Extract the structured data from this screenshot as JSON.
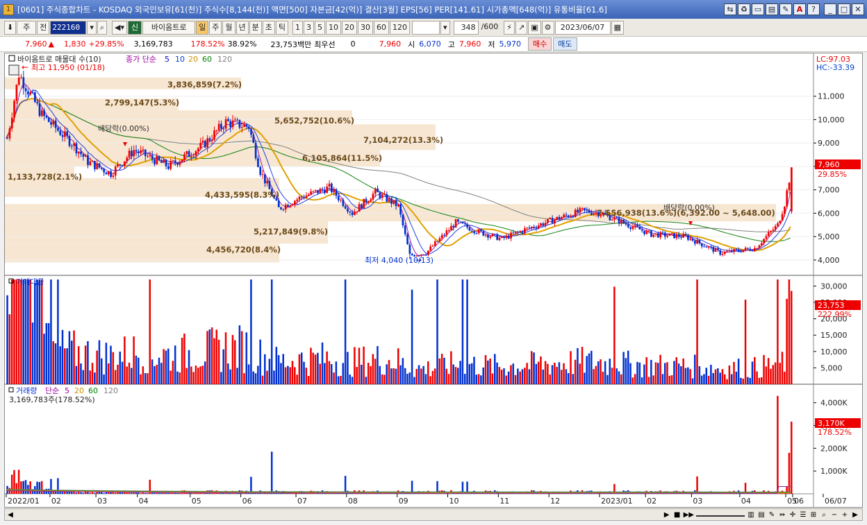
{
  "window": {
    "title": "[0601] 주식종합차트 - KOSDAQ 외국인보유[61(천)] 주식수[8,144(천)] 액면[500] 자본금[42(억)] 결산[3월] EPS[56] PER[141.61] 시가총액[648(억)] 유통비율[61.6]",
    "icon": "1"
  },
  "toolbar": {
    "period_select": "주",
    "jeon": "전",
    "code": "222160",
    "name": "바이옴트로",
    "shin": "신",
    "periods": [
      "일",
      "주",
      "월",
      "년",
      "분",
      "초",
      "틱"
    ],
    "active_period": "일",
    "intervals": [
      "1",
      "3",
      "5",
      "10",
      "20",
      "30",
      "60",
      "120"
    ],
    "count": "348",
    "count_total": "/600",
    "date": "2023/06/07"
  },
  "quote": {
    "price": "7,960",
    "arrow": "▲",
    "change": "1,830",
    "change_pct": "+29.85%",
    "volume": "3,169,783",
    "vol_ratio": "178.52%",
    "turnover": "38.92%",
    "amount": "23,753백만",
    "priority_label": "최우선",
    "priority_value": "0",
    "bid": "7,960",
    "open_label": "시",
    "open": "6,070",
    "high_label": "고",
    "high": "7,960",
    "low_label": "저",
    "low": "5,970",
    "buy": "매수",
    "sell": "매도"
  },
  "panel_price": {
    "title": "바이옴트로 매물대 수(10)",
    "ma_label": "종가 단순",
    "ma_periods": [
      "5",
      "10",
      "20",
      "60",
      "120"
    ],
    "lc": "LC:97.03",
    "hc": "HC:-33.39",
    "high_note": "최고 11,950 (01/18)",
    "low_note": "최저 4,040 (10/13)",
    "div_note1": "배당락(0.00%)",
    "div_note2": "배당락(0.00%)",
    "last_price": "7,960",
    "last_pct": "29.85%",
    "y_ticks": [
      "11,000",
      "10,000",
      "9,000",
      "8,000",
      "7,000",
      "6,000",
      "5,000",
      "4,000"
    ],
    "volume_profile": [
      "3,836,859(7.2%)",
      "2,799,147(5.3%)",
      "5,652,752(10.6%)",
      "7,104,272(13.3%)",
      "6,105,864(11.5%)",
      "1,133,728(2.1%)",
      "4,433,595(8.3%)",
      "7,556,938(13.6%)(6,392.00 ~ 5,648.00)",
      "5,217,849(9.8%)",
      "4,456,720(8.4%)"
    ]
  },
  "panel_amount": {
    "title": "거래대금",
    "last": "23,753",
    "last_pct": "222.99%",
    "y_ticks": [
      "30,000",
      "25,000",
      "20,000",
      "15,000",
      "10,000",
      "5,000"
    ]
  },
  "panel_volume": {
    "title": "거래량",
    "ma_label": "단순",
    "ma_periods": [
      "5",
      "20",
      "60",
      "120"
    ],
    "info": "3,169,783주(178.52%)",
    "last": "3,170K",
    "last_pct": "178.52%",
    "y_ticks": [
      "4,000K",
      "3,000K",
      "2,000K",
      "1,000K"
    ]
  },
  "x_axis": [
    "2022/01",
    "02",
    "03",
    "04",
    "05",
    "06",
    "07",
    "08",
    "09",
    "10",
    "11",
    "12",
    "2023/01",
    "02",
    "03",
    "04",
    "05",
    "06",
    "06/07"
  ],
  "chart_data": {
    "type": "candlestick",
    "title": "바이옴트로 일봉",
    "x_range": [
      "2022/01",
      "2023/06/07"
    ],
    "price_ylim": [
      3700,
      12000
    ],
    "price_high": 11950,
    "price_low": 4040,
    "last_close": 7960,
    "price_path": [
      [
        0,
        9200
      ],
      [
        5,
        11950
      ],
      [
        15,
        10200
      ],
      [
        28,
        9000
      ],
      [
        35,
        8200
      ],
      [
        45,
        7700
      ],
      [
        55,
        8700
      ],
      [
        70,
        8000
      ],
      [
        85,
        8900
      ],
      [
        95,
        9900
      ],
      [
        105,
        9700
      ],
      [
        110,
        7800
      ],
      [
        118,
        6200
      ],
      [
        128,
        6700
      ],
      [
        140,
        7100
      ],
      [
        150,
        6000
      ],
      [
        160,
        6900
      ],
      [
        170,
        6300
      ],
      [
        175,
        4200
      ],
      [
        182,
        4300
      ],
      [
        195,
        5600
      ],
      [
        205,
        5200
      ],
      [
        215,
        4900
      ],
      [
        225,
        5300
      ],
      [
        240,
        5800
      ],
      [
        250,
        6100
      ],
      [
        258,
        6000
      ],
      [
        270,
        5500
      ],
      [
        280,
        5100
      ],
      [
        295,
        5000
      ],
      [
        310,
        4300
      ],
      [
        325,
        4500
      ],
      [
        335,
        5500
      ],
      [
        338,
        6400
      ],
      [
        341,
        7960
      ]
    ],
    "amount_ylim": [
      0,
      32000
    ],
    "amount_last": 23753,
    "volume_ylim": [
      0,
      4600
    ],
    "volume_last": 3170
  }
}
